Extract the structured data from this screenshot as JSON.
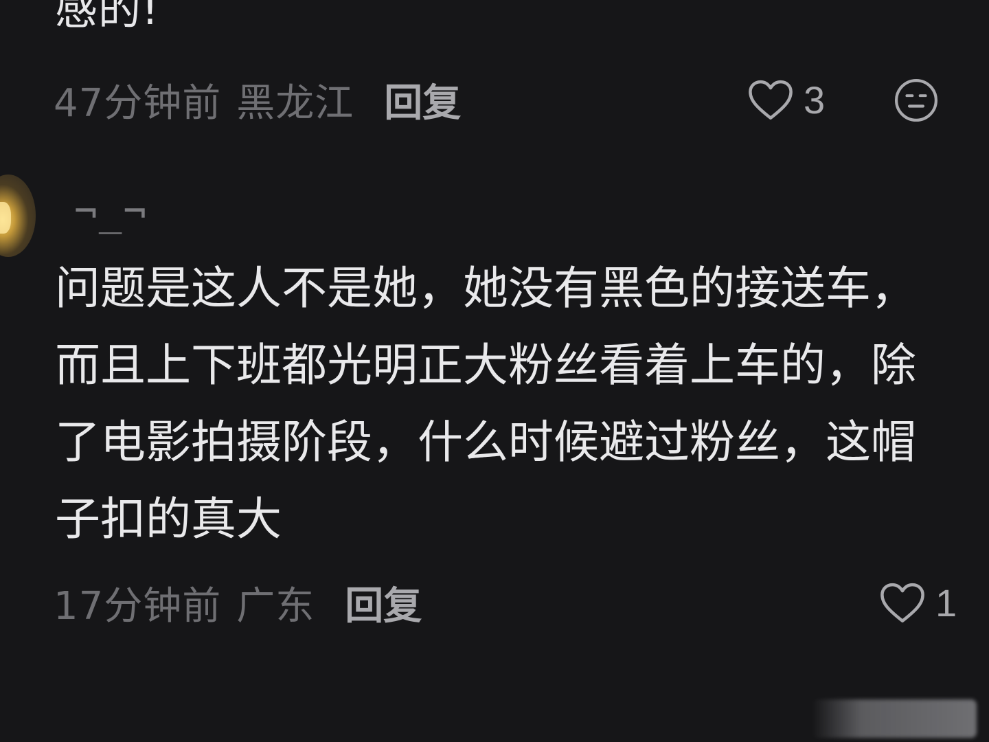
{
  "previous_comment": {
    "text_tail": "感的!",
    "time": "47分钟前",
    "location": "黑龙江",
    "reply_label": "回复",
    "like_count": "3",
    "like_icon": "heart-outline-icon",
    "emoji_icon": "neutral-face-icon"
  },
  "comment": {
    "username": "¬_¬",
    "lines": [
      "问题是这人不是她，她没有黑色的接送车，",
      "而且上下班都光明正大粉丝看着上车的，除",
      "了电影拍摄阶段，什么时候避过粉丝，这帽",
      "子扣的真大"
    ],
    "time": "17分钟前",
    "location": "广东",
    "reply_label": "回复",
    "like_count": "1",
    "like_icon": "heart-outline-icon"
  },
  "colors": {
    "background": "#161618",
    "primary_text": "#e9e9eb",
    "secondary_text": "#6f6f73",
    "action_text": "#a9a9ad"
  }
}
